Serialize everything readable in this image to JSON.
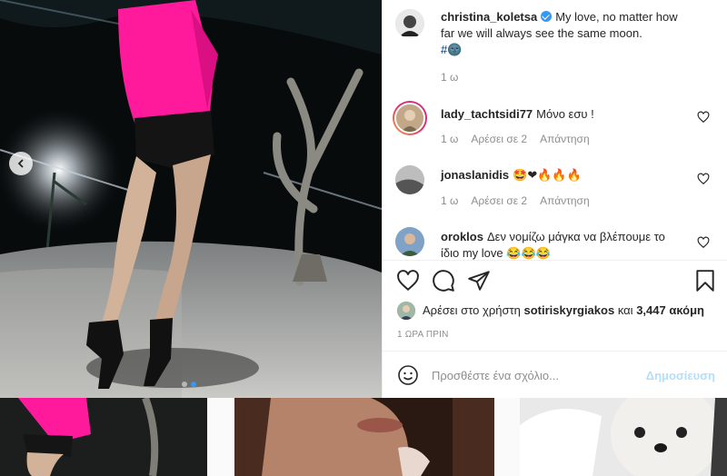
{
  "post": {
    "author": "christina_koletsa",
    "caption": "My love, no matter how far we will always see the same moon.",
    "hashtag": "#🌚",
    "age": "1 ω"
  },
  "comments": [
    {
      "username": "lady_tachtsidi77",
      "text": "Μόνο εσυ !",
      "age": "1 ω",
      "likes": "Αρέσει σε 2",
      "reply": "Απάντηση"
    },
    {
      "username": "jonaslanidis",
      "text": "🤩❤🔥🔥🔥",
      "age": "1 ω",
      "likes": "Αρέσει σε 2",
      "reply": "Απάντηση"
    },
    {
      "username": "oroklos",
      "text": "Δεν νομίζω μάγκα να βλέπουμε το ίδιο my love 😂😂😂"
    }
  ],
  "likes": {
    "prefix": "Αρέσει στο χρήστη",
    "user": "sotiriskyrgiakos",
    "joiner": "και",
    "count": "3,447 ακόμη"
  },
  "timestamp": "1 ΩΡΑ ΠΡΙΝ",
  "add_comment": {
    "placeholder": "Προσθέστε ένα σχόλιο...",
    "post_label": "Δημοσίευση"
  },
  "icons": [
    "chevron-left-icon",
    "heart-icon",
    "comment-icon",
    "share-icon",
    "bookmark-icon",
    "emoji-icon",
    "verified-icon"
  ],
  "colors": {
    "accent": "#3897f0",
    "post_disabled": "#b2dffc",
    "muted": "#8e8e8e"
  }
}
